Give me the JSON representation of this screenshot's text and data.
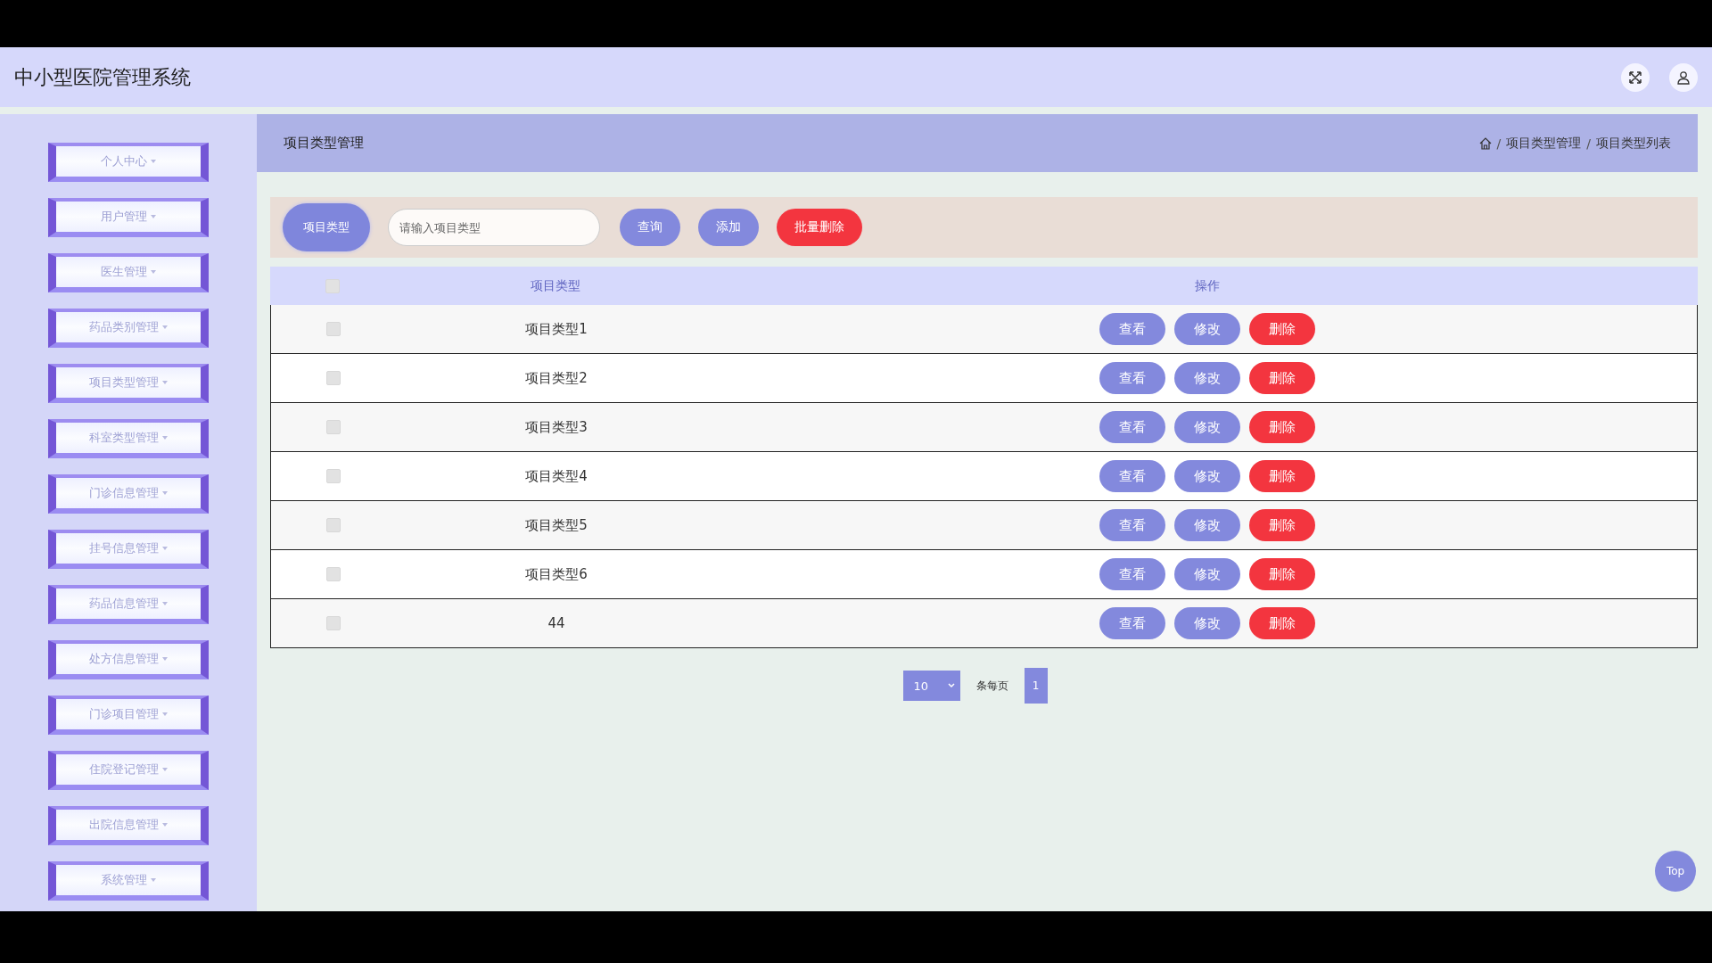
{
  "header": {
    "title": "中小型医院管理系统"
  },
  "sidebar": {
    "items": [
      {
        "label": "个人中心"
      },
      {
        "label": "用户管理"
      },
      {
        "label": "医生管理"
      },
      {
        "label": "药品类别管理"
      },
      {
        "label": "项目类型管理"
      },
      {
        "label": "科室类型管理"
      },
      {
        "label": "门诊信息管理"
      },
      {
        "label": "挂号信息管理"
      },
      {
        "label": "药品信息管理"
      },
      {
        "label": "处方信息管理"
      },
      {
        "label": "门诊项目管理"
      },
      {
        "label": "住院登记管理"
      },
      {
        "label": "出院信息管理"
      },
      {
        "label": "系统管理"
      }
    ]
  },
  "page_header": {
    "title": "项目类型管理",
    "breadcrumb": [
      "项目类型管理",
      "项目类型列表"
    ],
    "breadcrumb_separator": "/"
  },
  "toolbar": {
    "filter_label": "项目类型",
    "search": {
      "placeholder": "请输入项目类型"
    },
    "buttons": [
      {
        "label": "查询",
        "kind": "primary"
      },
      {
        "label": "添加",
        "kind": "primary"
      },
      {
        "label": "批量删除",
        "kind": "danger"
      }
    ]
  },
  "table": {
    "header_checked": false,
    "columns": [
      "项目类型",
      "操作"
    ],
    "rows": [
      {
        "checked": false,
        "type": "项目类型1",
        "actions": [
          {
            "label": "查看",
            "kind": "primary"
          },
          {
            "label": "修改",
            "kind": "primary"
          },
          {
            "label": "删除",
            "kind": "danger"
          }
        ]
      },
      {
        "checked": false,
        "type": "项目类型2",
        "actions": [
          {
            "label": "查看",
            "kind": "primary"
          },
          {
            "label": "修改",
            "kind": "primary"
          },
          {
            "label": "删除",
            "kind": "danger"
          }
        ]
      },
      {
        "checked": false,
        "type": "项目类型3",
        "actions": [
          {
            "label": "查看",
            "kind": "primary"
          },
          {
            "label": "修改",
            "kind": "primary"
          },
          {
            "label": "删除",
            "kind": "danger"
          }
        ]
      },
      {
        "checked": false,
        "type": "项目类型4",
        "actions": [
          {
            "label": "查看",
            "kind": "primary"
          },
          {
            "label": "修改",
            "kind": "primary"
          },
          {
            "label": "删除",
            "kind": "danger"
          }
        ]
      },
      {
        "checked": false,
        "type": "项目类型5",
        "actions": [
          {
            "label": "查看",
            "kind": "primary"
          },
          {
            "label": "修改",
            "kind": "primary"
          },
          {
            "label": "删除",
            "kind": "danger"
          }
        ]
      },
      {
        "checked": false,
        "type": "项目类型6",
        "actions": [
          {
            "label": "查看",
            "kind": "primary"
          },
          {
            "label": "修改",
            "kind": "primary"
          },
          {
            "label": "删除",
            "kind": "danger"
          }
        ]
      },
      {
        "checked": false,
        "type": "44",
        "actions": [
          {
            "label": "查看",
            "kind": "primary"
          },
          {
            "label": "修改",
            "kind": "primary"
          },
          {
            "label": "删除",
            "kind": "danger"
          }
        ]
      }
    ]
  },
  "pagination": {
    "page_size": "10",
    "page_size_label": "条每页",
    "pages": [
      {
        "label": "1",
        "selected": true
      }
    ]
  },
  "back_to_top": "Top"
}
